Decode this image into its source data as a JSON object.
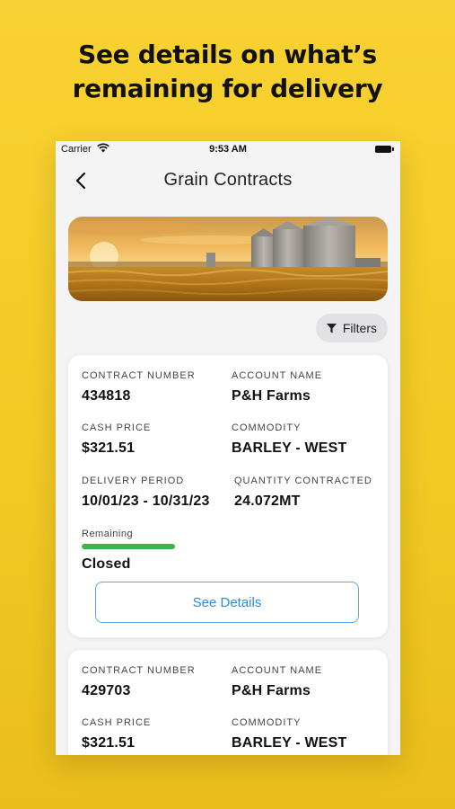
{
  "headline": {
    "line1": "See details on what’s",
    "line2": "remaining for delivery"
  },
  "status_bar": {
    "carrier": "Carrier",
    "time": "9:53 AM"
  },
  "nav": {
    "title": "Grain Contracts",
    "back_icon": "chevron-left-icon"
  },
  "filters_label": "Filters",
  "contracts": [
    {
      "contract_number_label": "CONTRACT NUMBER",
      "contract_number": "434818",
      "account_name_label": "ACCOUNT NAME",
      "account_name": "P&H Farms",
      "cash_price_label": "CASH PRICE",
      "cash_price": "$321.51",
      "commodity_label": "COMMODITY",
      "commodity": "BARLEY - WEST",
      "delivery_period_label": "DELIVERY PERIOD",
      "delivery_period": "10/01/23 - 10/31/23",
      "quantity_label": "QUANTITY CONTRACTED",
      "quantity": "24.072MT",
      "remaining_label": "Remaining",
      "remaining_fraction": 0.3,
      "status": "Closed",
      "details_button": "See Details"
    },
    {
      "contract_number_label": "CONTRACT NUMBER",
      "contract_number": "429703",
      "account_name_label": "ACCOUNT NAME",
      "account_name": "P&H Farms",
      "cash_price_label": "CASH PRICE",
      "cash_price": "$321.51",
      "commodity_label": "COMMODITY",
      "commodity": "BARLEY - WEST"
    }
  ],
  "colors": {
    "background": "#f5cd2a",
    "progress": "#3cb44b",
    "button_border": "#5aa9e6",
    "button_text": "#2f8ad6"
  }
}
